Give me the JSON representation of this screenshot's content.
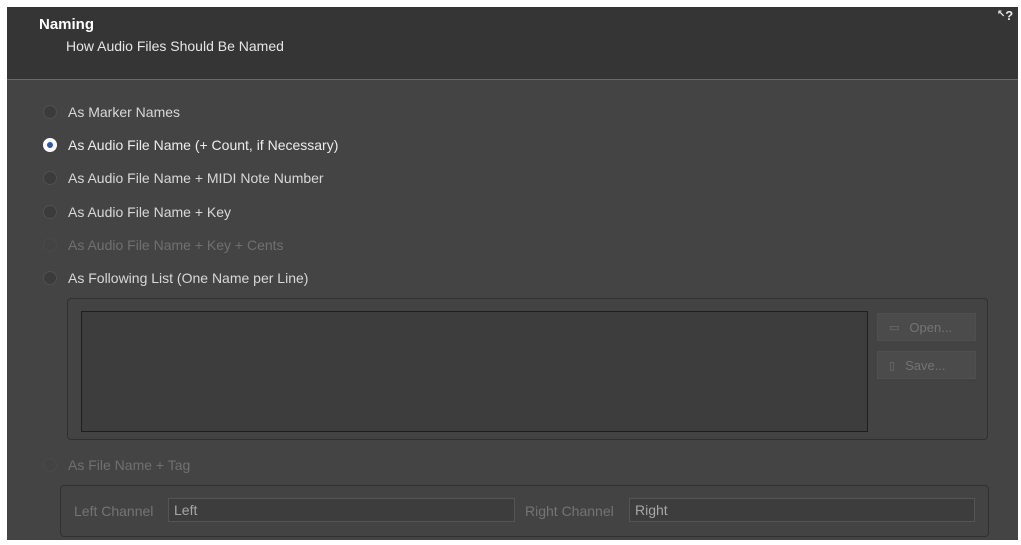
{
  "header": {
    "title": "Naming",
    "subtitle": "How Audio Files Should Be Named",
    "help_icon": "context-help-icon"
  },
  "options": [
    {
      "label": "As Marker Names",
      "checked": false,
      "enabled": true
    },
    {
      "label": "As Audio File Name (+ Count, if Necessary)",
      "checked": true,
      "enabled": true
    },
    {
      "label": "As Audio File Name + MIDI Note Number",
      "checked": false,
      "enabled": true
    },
    {
      "label": "As Audio File Name + Key",
      "checked": false,
      "enabled": true
    },
    {
      "label": "As Audio File Name + Key + Cents",
      "checked": false,
      "enabled": false
    },
    {
      "label": "As Following List (One Name per Line)",
      "checked": false,
      "enabled": true
    },
    {
      "label": "As File Name + Tag",
      "checked": false,
      "enabled": false
    }
  ],
  "list": {
    "value": "",
    "open_label": "Open...",
    "open_icon": "folder-icon",
    "save_label": "Save...",
    "save_icon": "save-icon"
  },
  "channels": {
    "left_label": "Left Channel",
    "left_value": "Left",
    "right_label": "Right Channel",
    "right_value": "Right"
  },
  "colors": {
    "panel": "#444444",
    "header": "#353535",
    "radio_selected": "#2a5aa8"
  }
}
